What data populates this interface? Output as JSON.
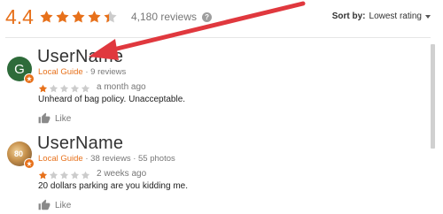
{
  "summary": {
    "rating": "4.4",
    "stars_filled": 4.4,
    "review_count": "4,180 reviews",
    "help_icon": "question-circle-icon"
  },
  "sort": {
    "label": "Sort by:",
    "value": "Lowest rating"
  },
  "reviews": [
    {
      "avatar_letter": "G",
      "user_name": "UserName",
      "guide": "Local Guide",
      "separator": "·",
      "stats": "9 reviews",
      "rating": 1,
      "time": "a month ago",
      "text": "Unheard of bag policy. Unacceptable.",
      "like_label": "Like"
    },
    {
      "avatar_text": "80",
      "user_name": "UserName",
      "guide": "Local Guide",
      "separator": "·",
      "stats": "38 reviews · 55 photos",
      "rating": 1,
      "time": "2 weeks ago",
      "text": "20 dollars parking are you kidding me.",
      "like_label": "Like"
    }
  ],
  "colors": {
    "accent": "#e7711b",
    "annotation_arrow": "#e0383e",
    "star_empty": "#cccccc"
  }
}
